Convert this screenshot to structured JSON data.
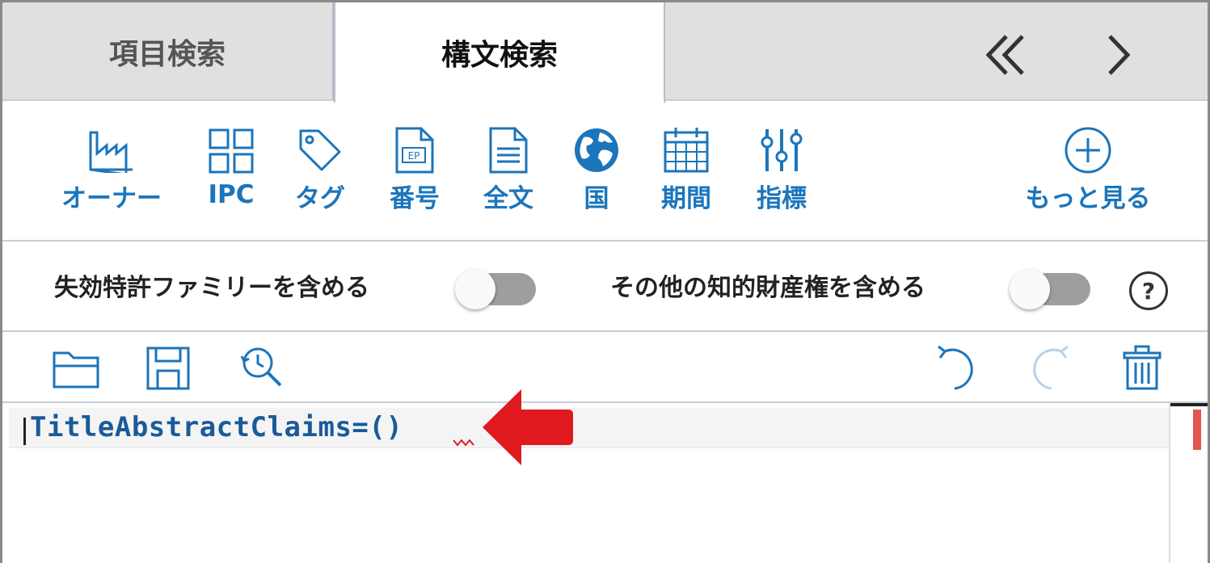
{
  "tabs": [
    {
      "label": "項目検索",
      "active": false
    },
    {
      "label": "構文検索",
      "active": true
    }
  ],
  "nav": {
    "rewind_icon": "double-chevron-left-icon",
    "next_icon": "chevron-right-icon"
  },
  "toolbar": {
    "items": [
      {
        "label": "オーナー",
        "icon": "factory-icon"
      },
      {
        "label": "IPC",
        "icon": "grid-icon"
      },
      {
        "label": "タグ",
        "icon": "tag-icon"
      },
      {
        "label": "番号",
        "icon": "document-ep-icon"
      },
      {
        "label": "全文",
        "icon": "document-text-icon"
      },
      {
        "label": "国",
        "icon": "globe-icon"
      },
      {
        "label": "期間",
        "icon": "calendar-icon"
      },
      {
        "label": "指標",
        "icon": "sliders-icon"
      }
    ],
    "more": {
      "label": "もっと見る",
      "icon": "plus-circle-icon"
    }
  },
  "toggles": {
    "expired_family": {
      "label": "失効特許ファミリーを含める",
      "on": false
    },
    "other_ip": {
      "label": "その他の知的財産権を含める",
      "on": false
    },
    "help_label": "?"
  },
  "editor": {
    "query": "TitleAbstractClaims=()",
    "tools": [
      "folder-open-icon",
      "save-icon",
      "history-search-icon",
      "undo-icon",
      "redo-icon",
      "trash-icon"
    ]
  },
  "colors": {
    "accent": "#1b75bb",
    "annotation_arrow": "#e0191f",
    "toggle_track": "#9e9e9e",
    "tab_bar": "#e0e0e0"
  }
}
